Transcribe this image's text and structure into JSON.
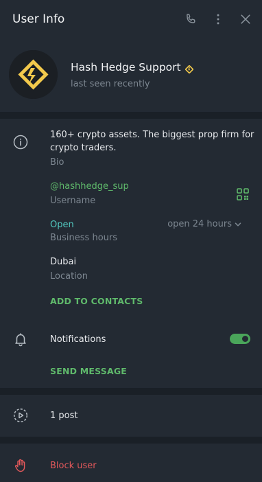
{
  "header": {
    "title": "User Info"
  },
  "profile": {
    "name": "Hash Hedge Support",
    "status": "last seen recently",
    "accent": "#f2c94c"
  },
  "info": {
    "bio_text_line1": "160+ crypto assets. The biggest prop firm for",
    "bio_text_line2": "crypto traders.",
    "bio_label": "Bio",
    "username": "@hashhedge_sup",
    "username_label": "Username",
    "hours_status": "Open",
    "hours_value": "open 24 hours",
    "hours_label": "Business hours",
    "location": "Dubai",
    "location_label": "Location",
    "add_contacts": "ADD TO CONTACTS"
  },
  "notifications": {
    "label": "Notifications",
    "enabled": true,
    "send_message": "SEND MESSAGE"
  },
  "posts": {
    "label": "1 post"
  },
  "block": {
    "label": "Block user"
  },
  "colors": {
    "green": "#5fb96b",
    "teal": "#52c9c0",
    "danger": "#e4595b",
    "muted": "#7d8791"
  },
  "icons": [
    "phone-icon",
    "more-icon",
    "close-icon",
    "info-icon",
    "qr-code-icon",
    "chevron-down-icon",
    "bell-icon",
    "play-circle-icon",
    "hand-icon",
    "verified-icon"
  ]
}
